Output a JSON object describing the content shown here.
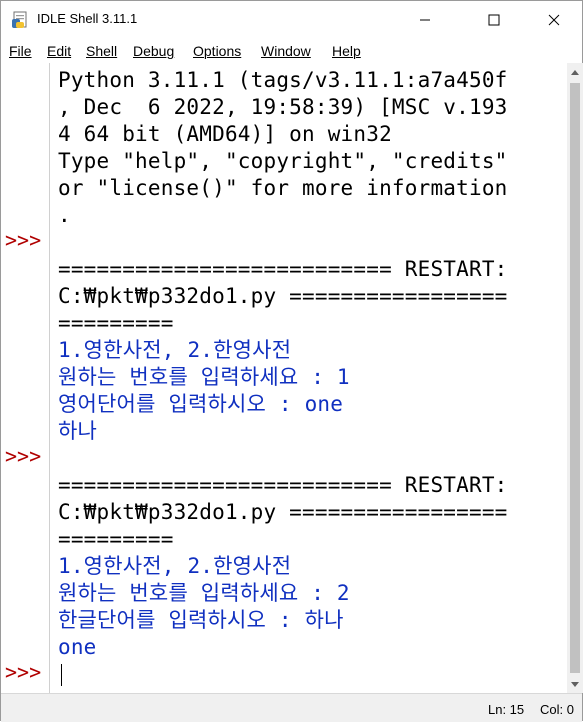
{
  "window": {
    "title": "IDLE Shell 3.11.1",
    "icon": "idle-shell-icon",
    "buttons": [
      "minimize-icon",
      "maximize-icon",
      "close-icon"
    ]
  },
  "menu": [
    "File",
    "Edit",
    "Shell",
    "Debug",
    "Options",
    "Window",
    "Help"
  ],
  "shell": {
    "prompt": ">>>",
    "lines": [
      {
        "text": "Python 3.11.1 (tags/v3.11.1:a7a450f",
        "color": "black"
      },
      {
        "text": ", Dec  6 2022, 19:58:39) [MSC v.193",
        "color": "black"
      },
      {
        "text": "4 64 bit (AMD64)] on win32",
        "color": "black"
      },
      {
        "text": "Type \"help\", \"copyright\", \"credits\"",
        "color": "black"
      },
      {
        "text": "or \"license()\" for more information",
        "color": "black"
      },
      {
        "text": ".",
        "color": "black"
      },
      {
        "text": "",
        "color": "black"
      },
      {
        "text": "========================== RESTART:",
        "color": "black"
      },
      {
        "text": "C:₩pkt₩p332do1.py =================",
        "color": "black"
      },
      {
        "text": "=========",
        "color": "black"
      },
      {
        "text": "1.영한사전, 2.한영사전",
        "color": "blue"
      },
      {
        "text": "원하는 번호를 입력하세요 : 1",
        "color": "blue"
      },
      {
        "text": "영어단어를 입력하시오 : one",
        "color": "blue"
      },
      {
        "text": "하나",
        "color": "blue"
      },
      {
        "text": "",
        "color": "black"
      },
      {
        "text": "========================== RESTART:",
        "color": "black"
      },
      {
        "text": "C:₩pkt₩p332do1.py =================",
        "color": "black"
      },
      {
        "text": "=========",
        "color": "black"
      },
      {
        "text": "1.영한사전, 2.한영사전",
        "color": "blue"
      },
      {
        "text": "원하는 번호를 입력하세요 : 2",
        "color": "blue"
      },
      {
        "text": "한글단어를 입력하시오 : 하나",
        "color": "blue"
      },
      {
        "text": "one",
        "color": "blue"
      }
    ]
  },
  "status": {
    "line": "Ln: 15",
    "col": "Col: 0"
  },
  "colors": {
    "prompt": "#b00000",
    "stdout": "#1030c0",
    "text": "#000000"
  }
}
